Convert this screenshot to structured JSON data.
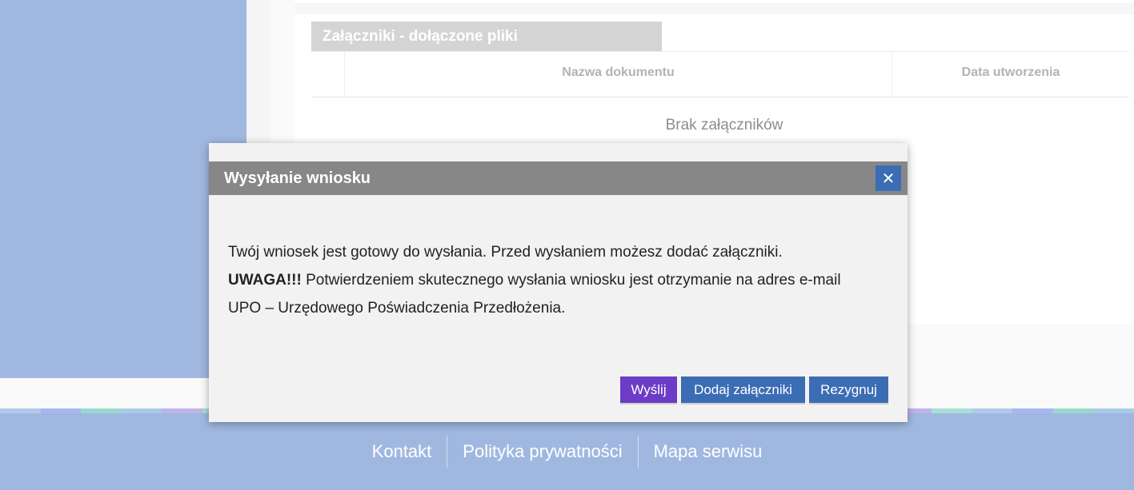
{
  "attachments": {
    "section_title": "Załączniki - dołączone pliki",
    "columns": [
      "Nazwa dokumentu",
      "Data utworzenia"
    ],
    "empty_text": "Brak załączników"
  },
  "modal": {
    "title": "Wysyłanie wniosku",
    "close_symbol": "✕",
    "line1": "Twój wniosek jest gotowy do wysłania. Przed wysłaniem możesz dodać załączniki.",
    "warning_label": "UWAGA!!!",
    "line2": " Potwierdzeniem skutecznego wysłania wniosku jest otrzymanie na adres e-mail",
    "line3": "UPO – Urzędowego Poświadczenia Przedłożenia.",
    "buttons": {
      "send": "Wyślij",
      "add_attachments": "Dodaj załączniki",
      "cancel": "Rezygnuj"
    }
  },
  "footer": {
    "links": [
      "Kontakt",
      "Polityka prywatności",
      "Mapa serwisu"
    ]
  },
  "colors": {
    "page_bg": "#a0b8e0",
    "modal_header": "#878787",
    "primary_button": "#3b6db5",
    "send_button": "#6c3cc7",
    "stripe": [
      "#b4c6ea",
      "#a7b5f0",
      "#9ad8cf",
      "#a9cbe8",
      "#c0b3ea",
      "#a8dfd9"
    ]
  }
}
